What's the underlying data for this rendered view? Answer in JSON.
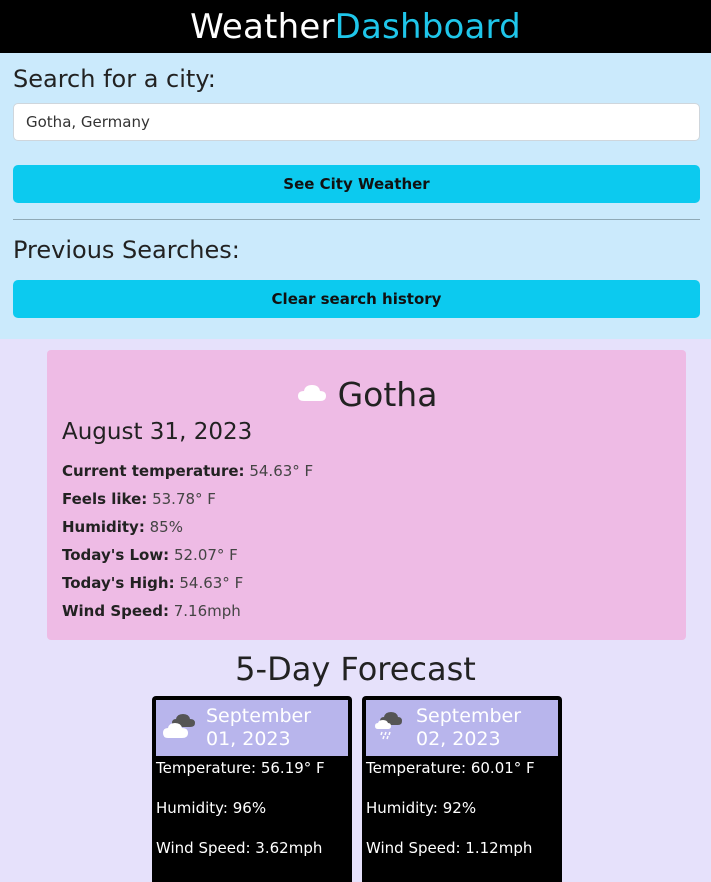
{
  "header": {
    "title_part1": "Weather",
    "title_part2": "Dashboard"
  },
  "search": {
    "heading": "Search for a city:",
    "input_value": "Gotha, Germany",
    "button_label": "See City Weather",
    "previous_heading": "Previous Searches:",
    "clear_label": "Clear search history"
  },
  "current": {
    "icon": "cloud-icon",
    "city": "Gotha",
    "date": "August 31, 2023",
    "stats": [
      {
        "label": "Current temperature:",
        "value": "54.63° F"
      },
      {
        "label": "Feels like:",
        "value": "53.78° F"
      },
      {
        "label": "Humidity:",
        "value": "85%"
      },
      {
        "label": "Today's Low:",
        "value": "52.07° F"
      },
      {
        "label": "Today's High:",
        "value": "54.63° F"
      },
      {
        "label": "Wind Speed:",
        "value": "7.16mph"
      }
    ]
  },
  "forecast": {
    "title": "5-Day Forecast",
    "days": [
      {
        "icon": "broken-clouds-icon",
        "date_line1": "September",
        "date_line2": "01, 2023",
        "temperature": "Temperature: 56.19° F",
        "humidity": "Humidity: 96%",
        "wind": "Wind Speed: 3.62mph"
      },
      {
        "icon": "rain-icon",
        "date_line1": "September",
        "date_line2": "02, 2023",
        "temperature": "Temperature: 60.01° F",
        "humidity": "Humidity: 92%",
        "wind": "Wind Speed: 1.12mph"
      }
    ]
  },
  "colors": {
    "header_bg": "#000000",
    "brand_accent": "#1fc6ea",
    "search_bg": "#cbeafc",
    "button": "#0ccaef",
    "current_card": "#eebbe5",
    "page_bg": "#e6e1fb",
    "forecast_head": "#b8b5ec"
  }
}
